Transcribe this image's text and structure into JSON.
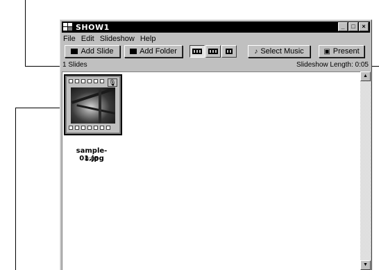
{
  "window": {
    "title": "SHOW1"
  },
  "window_buttons": {
    "minimize": "_",
    "maximize": "□",
    "close": "×"
  },
  "menu": [
    "File",
    "Edit",
    "Slideshow",
    "Help"
  ],
  "toolbar": {
    "add_slide": "Add Slide",
    "add_folder": "Add Folder",
    "select_music": "Select Music",
    "present": "Present"
  },
  "status": {
    "slides_count": "1 Slides",
    "show_length": "Slideshow Length: 0:05"
  },
  "slides": [
    {
      "name": "sample-01.jpg",
      "duration": "0:05"
    }
  ]
}
